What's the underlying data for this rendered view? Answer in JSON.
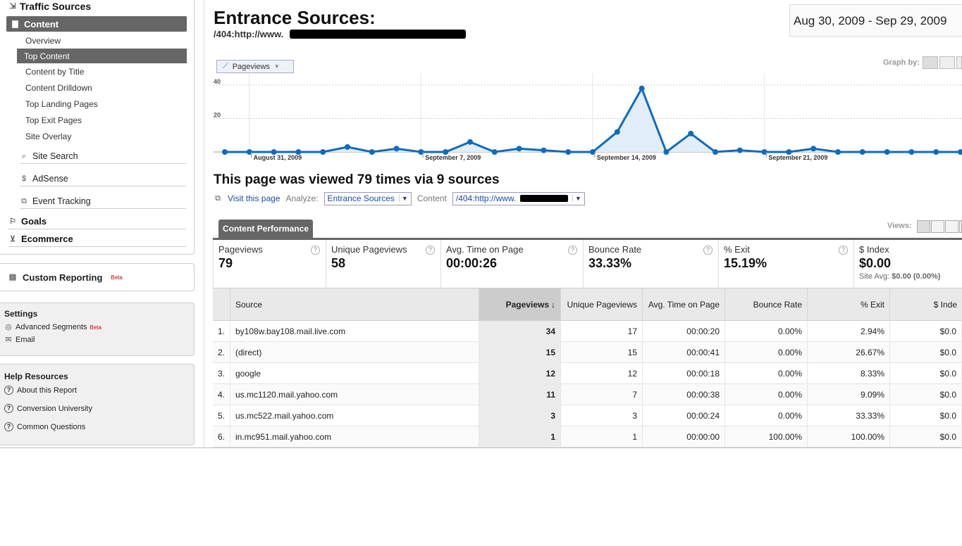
{
  "sidebar": {
    "traffic_sources": "Traffic Sources",
    "content": "Content",
    "sub_items": [
      "Overview",
      "Top Content",
      "Content by Title",
      "Content Drilldown",
      "Top Landing Pages",
      "Top Exit Pages",
      "Site Overlay"
    ],
    "site_search": "Site Search",
    "adsense": "AdSense",
    "event_tracking": "Event Tracking",
    "goals": "Goals",
    "ecommerce": "Ecommerce",
    "custom_reporting": "Custom Reporting",
    "beta": "Beta",
    "settings_title": "Settings",
    "advanced_segments": "Advanced Segments",
    "email": "Email",
    "help_title": "Help Resources",
    "help_items": [
      "About this Report",
      "Conversion University",
      "Common Questions"
    ]
  },
  "header": {
    "title": "Entrance Sources:",
    "subtitle": "/404:http://www.",
    "date_range": "Aug 30, 2009 - Sep 29, 2009",
    "graph_by": "Graph by:",
    "metric": "Pageviews"
  },
  "chart_data": {
    "type": "line",
    "series": [
      {
        "name": "Pageviews",
        "values": [
          0,
          0,
          0,
          0,
          0,
          3,
          0,
          2,
          0,
          0,
          6,
          0,
          2,
          1,
          0,
          0,
          12,
          38,
          0,
          11,
          0,
          1,
          0,
          0,
          2,
          0,
          0,
          0,
          0,
          0,
          0,
          0
        ]
      }
    ],
    "y_ticks": [
      20,
      40
    ],
    "ylim": [
      0,
      45
    ],
    "x_labels": [
      {
        "index": 2,
        "label": "August 31, 2009"
      },
      {
        "index": 9,
        "label": "September 7, 2009"
      },
      {
        "index": 16,
        "label": "September 14, 2009"
      },
      {
        "index": 23,
        "label": "September 21, 2009"
      }
    ],
    "color": "#0c6cbf"
  },
  "summary": {
    "headline": "This page was viewed 79 times via 9 sources",
    "visit": "Visit this page",
    "analyze_label": "Analyze:",
    "analyze_value": "Entrance Sources",
    "content_label": "Content",
    "content_value": "/404:http://www."
  },
  "tab": "Content Performance",
  "views_label": "Views:",
  "scorecards": [
    {
      "label": "Pageviews",
      "value": "79"
    },
    {
      "label": "Unique Pageviews",
      "value": "58"
    },
    {
      "label": "Avg. Time on Page",
      "value": "00:00:26"
    },
    {
      "label": "Bounce Rate",
      "value": "33.33%"
    },
    {
      "label": "% Exit",
      "value": "15.19%"
    },
    {
      "label": "$ Index",
      "value": "$0.00",
      "avg_label": "Site Avg:",
      "avg_value": "$0.00 (0.00%)"
    }
  ],
  "table": {
    "headers": [
      "Source",
      "Pageviews",
      "Unique Pageviews",
      "Avg. Time on Page",
      "Bounce Rate",
      "% Exit",
      "$ Inde"
    ],
    "sort_arrow": "↓",
    "rows": [
      {
        "n": "1.",
        "source": "by108w.bay108.mail.live.com",
        "pv": "34",
        "upv": "17",
        "time": "00:00:20",
        "bounce": "0.00%",
        "exit": "2.94%",
        "idx": "$0.0"
      },
      {
        "n": "2.",
        "source": "(direct)",
        "pv": "15",
        "upv": "15",
        "time": "00:00:41",
        "bounce": "0.00%",
        "exit": "26.67%",
        "idx": "$0.0"
      },
      {
        "n": "3.",
        "source": "google",
        "pv": "12",
        "upv": "12",
        "time": "00:00:18",
        "bounce": "0.00%",
        "exit": "8.33%",
        "idx": "$0.0"
      },
      {
        "n": "4.",
        "source": "us.mc1120.mail.yahoo.com",
        "pv": "11",
        "upv": "7",
        "time": "00:00:38",
        "bounce": "0.00%",
        "exit": "9.09%",
        "idx": "$0.0"
      },
      {
        "n": "5.",
        "source": "us.mc522.mail.yahoo.com",
        "pv": "3",
        "upv": "3",
        "time": "00:00:24",
        "bounce": "0.00%",
        "exit": "33.33%",
        "idx": "$0.0"
      },
      {
        "n": "6.",
        "source": "in.mc951.mail.yahoo.com",
        "pv": "1",
        "upv": "1",
        "time": "00:00:00",
        "bounce": "100.00%",
        "exit": "100.00%",
        "idx": "$0.0"
      }
    ]
  }
}
